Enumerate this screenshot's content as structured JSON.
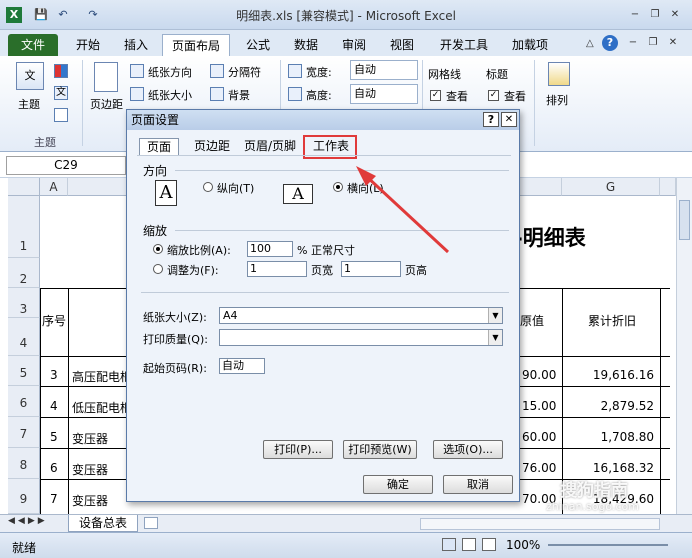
{
  "window": {
    "title": "明细表.xls [兼容模式] - Microsoft Excel"
  },
  "quick_access": {
    "save": "💾",
    "undo": "↶",
    "redo": "↷"
  },
  "window_controls": {
    "minimize": "−",
    "restore": "❐",
    "close": "✕"
  },
  "ribbon_controls": {
    "minimize": "−",
    "restore": "❐",
    "close": "✕",
    "help": "?",
    "collapse": "△"
  },
  "ribbon_tabs": [
    "文件",
    "开始",
    "插入",
    "页面布局",
    "公式",
    "数据",
    "审阅",
    "视图",
    "开发工具",
    "加载项"
  ],
  "ribbon": {
    "themes_label": "主题",
    "themes_group": "主题",
    "margins_label": "页边距",
    "orientation_label": "纸张方向",
    "size_label": "纸张大小",
    "breaks_label": "分隔符",
    "background_label": "背景",
    "width_label": "宽度:",
    "width_value": "自动",
    "height_label": "高度:",
    "height_value": "自动",
    "gridlines_label": "网格线",
    "gridlines_view": "查看",
    "headings_label": "标题",
    "headings_view": "查看",
    "arrange_label": "排列"
  },
  "formula_bar": {
    "cell_ref": "C29"
  },
  "sheet": {
    "col_a": "A",
    "col_g": "G",
    "title_fragment": "明细表",
    "header_seq": "序号",
    "header_value_fragment": "原值",
    "header_depr": "累计折旧",
    "row_numbers": [
      "1",
      "2",
      "3",
      "4",
      "5",
      "6",
      "7",
      "8",
      "9"
    ],
    "rows": [
      {
        "seq": "3",
        "name": "高压配电柜",
        "val": "90.00",
        "depr": "19,616.16"
      },
      {
        "seq": "4",
        "name": "低压配电柜",
        "val": "15.00",
        "depr": "2,879.52"
      },
      {
        "seq": "5",
        "name": "变压器",
        "val": "60.00",
        "depr": "1,708.80"
      },
      {
        "seq": "6",
        "name": "变压器",
        "val": "76.00",
        "depr": "16,168.32"
      },
      {
        "seq": "7",
        "name": "变压器",
        "val": "70.00",
        "depr": "18,429.60"
      }
    ]
  },
  "sheet_tabs": {
    "active": "设备总表"
  },
  "status": {
    "ready": "就绪",
    "zoom": "100%"
  },
  "dialog": {
    "title": "页面设置",
    "help": "?",
    "close": "✕",
    "tabs": [
      "页面",
      "页边距",
      "页眉/页脚",
      "工作表"
    ],
    "orientation_group": "方向",
    "portrait": "纵向(T)",
    "landscape": "横向(L)",
    "scaling_group": "缩放",
    "scale_label": "缩放比例(A):",
    "scale_value": "100",
    "scale_unit": "% 正常尺寸",
    "fit_label": "调整为(F):",
    "fit_wide_value": "1",
    "fit_wide_unit": "页宽",
    "fit_tall_value": "1",
    "fit_tall_unit": "页高",
    "paper_size_label": "纸张大小(Z):",
    "paper_size_value": "A4",
    "print_quality_label": "打印质量(Q):",
    "print_quality_value": "",
    "first_page_label": "起始页码(R):",
    "first_page_value": "自动",
    "print_btn": "打印(P)...",
    "preview_btn": "打印预览(W)",
    "options_btn": "选项(O)...",
    "ok_btn": "确定",
    "cancel_btn": "取消"
  },
  "annotation_color": "#e03a3a",
  "watermark": {
    "text": "搜狗指南",
    "sub": "zhinan.sogo.com"
  }
}
